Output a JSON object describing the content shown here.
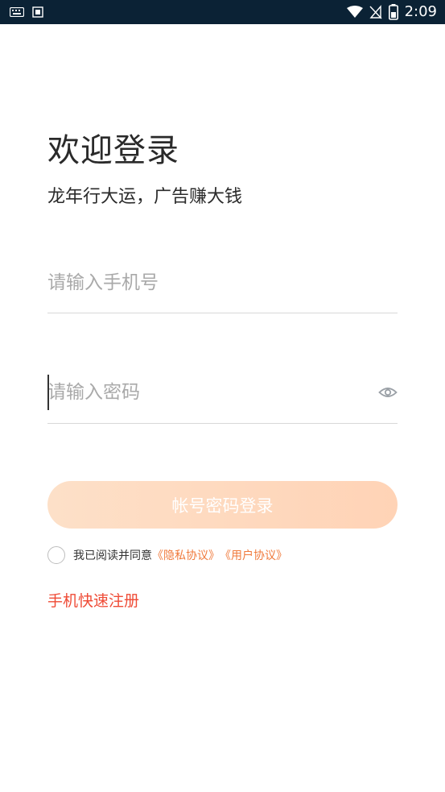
{
  "status_bar": {
    "time": "2:09",
    "icons": [
      "keyboard-icon",
      "sim-icon",
      "wifi-icon",
      "no-signal-icon",
      "battery-icon"
    ]
  },
  "header": {
    "title": "欢迎登录",
    "subtitle": "龙年行大运，广告赚大钱"
  },
  "form": {
    "phone_placeholder": "请输入手机号",
    "password_placeholder": "请输入密码",
    "login_button_label": "帐号密码登录"
  },
  "agreement": {
    "prefix": "我已阅读并同意",
    "privacy_link": "《隐私协议》",
    "user_link": "《用户协议》"
  },
  "quick_register_label": "手机快速注册",
  "colors": {
    "status_bar": "#0b2235",
    "accent_orange": "#f07a3c",
    "register_red": "#ef4b36",
    "button_gradient_start": "#fde0c8",
    "button_gradient_end": "#ffd3b6"
  }
}
